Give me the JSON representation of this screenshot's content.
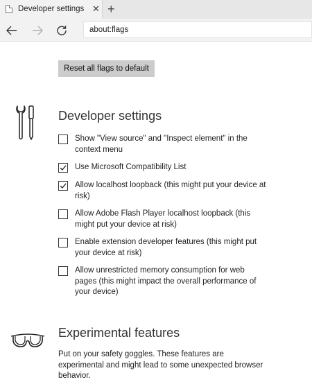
{
  "tab": {
    "title": "Developer settings",
    "close_glyph": "✕",
    "new_tab_glyph": "+"
  },
  "address_bar": {
    "url": "about:flags"
  },
  "reset_button": {
    "label": "Reset all flags to default"
  },
  "developer_settings": {
    "title": "Developer settings",
    "icon": "tools-icon",
    "flags": [
      {
        "label": "Show \"View source\" and \"Inspect element\" in the context menu",
        "checked": false
      },
      {
        "label": "Use Microsoft Compatibility List",
        "checked": true
      },
      {
        "label": "Allow localhost loopback (this might put your device at risk)",
        "checked": true
      },
      {
        "label": "Allow Adobe Flash Player localhost loopback (this might put your device at risk)",
        "checked": false
      },
      {
        "label": "Enable extension developer features (this might put your device at risk)",
        "checked": false
      },
      {
        "label": "Allow unrestricted memory consumption for web pages (this might impact the overall performance of your device)",
        "checked": false
      }
    ]
  },
  "experimental_features": {
    "title": "Experimental features",
    "icon": "goggles-icon",
    "description": "Put on your safety goggles. These features are experimental and might lead to some unexpected browser behavior."
  }
}
